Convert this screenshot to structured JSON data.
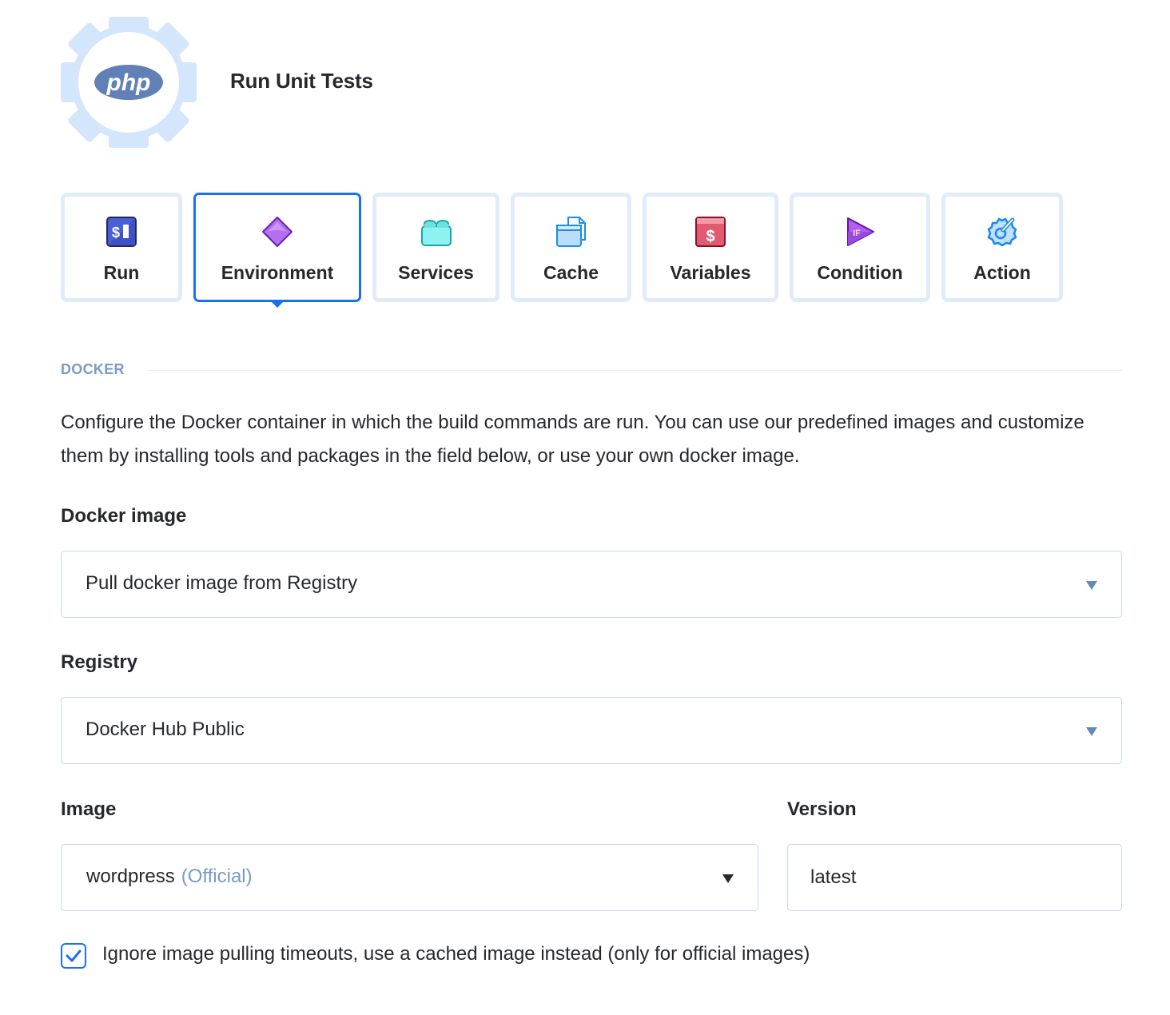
{
  "header": {
    "logo_icon": "php-gear-logo",
    "logo_text": "php",
    "title": "Run Unit Tests"
  },
  "tabs": [
    {
      "label": "Run",
      "icon": "terminal-dollar-icon",
      "active": false
    },
    {
      "label": "Environment",
      "icon": "diamond-icon",
      "active": true
    },
    {
      "label": "Services",
      "icon": "lego-block-icon",
      "active": false
    },
    {
      "label": "Cache",
      "icon": "folder-files-icon",
      "active": false
    },
    {
      "label": "Variables",
      "icon": "dollar-window-icon",
      "active": false
    },
    {
      "label": "Condition",
      "icon": "if-play-icon",
      "active": false
    },
    {
      "label": "Action",
      "icon": "wrench-gear-icon",
      "active": false
    }
  ],
  "section": {
    "title": "DOCKER",
    "description": "Configure the Docker container in which the build commands are run. You can use our predefined images and customize them by installing tools and packages in the field below, or use your own docker image."
  },
  "form": {
    "docker_image": {
      "label": "Docker image",
      "value": "Pull docker image from Registry"
    },
    "registry": {
      "label": "Registry",
      "value": "Docker Hub Public"
    },
    "image": {
      "label": "Image",
      "value": "wordpress",
      "hint": "(Official)"
    },
    "version": {
      "label": "Version",
      "value": "latest"
    },
    "ignore_timeouts": {
      "label": "Ignore image pulling timeouts, use a cached image instead (only for official images)",
      "checked": true
    }
  },
  "colors": {
    "accent": "#1c70f0",
    "tab_border": "#e1ecfb",
    "section_label": "#7a9bc4",
    "php_blue": "#6181b6"
  }
}
